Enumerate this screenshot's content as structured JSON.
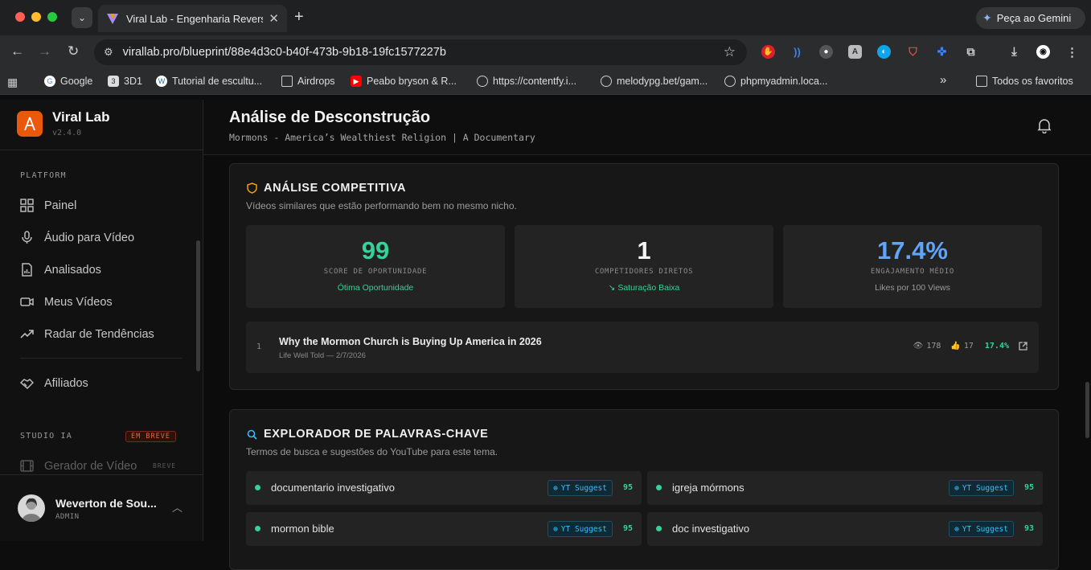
{
  "browser": {
    "tab_title": "Viral Lab - Engenharia Reversa",
    "tab_close": "✕",
    "gemini_label": "Peça ao Gemini",
    "url": "virallab.pro/blueprint/88e4d3c0-b40f-473b-9b18-19fc1577227b",
    "bookmarks": [
      "Google",
      "3D1",
      "Tutorial de escultu...",
      "Airdrops",
      "Peabo bryson & R...",
      "https://contentfy.i...",
      "melodypg.bet/gam...",
      "phpmyadmin.loca..."
    ],
    "all_bookmarks": "Todos os favoritos",
    "more_bookmarks": "»",
    "colors": {
      "chrome_dark": "#1f2021",
      "toolbar": "#2b2c2e"
    }
  },
  "sidebar": {
    "brand": "Viral Lab",
    "version": "v2.4.0",
    "platform_label": "PLATFORM",
    "items": [
      {
        "label": "Painel",
        "icon": "grid-icon"
      },
      {
        "label": "Áudio para Vídeo",
        "icon": "mic-icon"
      },
      {
        "label": "Analisados",
        "icon": "report-icon"
      },
      {
        "label": "Meus Vídeos",
        "icon": "video-icon"
      },
      {
        "label": "Radar de Tendências",
        "icon": "trending-icon"
      }
    ],
    "affiliates": "Afiliados",
    "studio_label": "STUDIO IA",
    "soon_badge": "EM BREVE",
    "studio_item": "Gerador de Vídeo",
    "studio_item_badge": "BREVE",
    "user": {
      "name": "Weverton de Sou...",
      "role": "ADMIN"
    },
    "accent": "#ea580c"
  },
  "header": {
    "title": "Análise de Desconstrução",
    "subtitle": "Mormons - America’s Wealthiest Religion | A Documentary"
  },
  "competitive": {
    "title": "ANÁLISE COMPETITIVA",
    "desc": "Vídeos similares que estão performando bem no mesmo nicho.",
    "stats": [
      {
        "value": "99",
        "label": "SCORE DE OPORTUNIDADE",
        "note": "Ótima Oportunidade",
        "color": "#34d399",
        "note_color": "#34d399"
      },
      {
        "value": "1",
        "label": "COMPETIDORES DIRETOS",
        "note": "Saturação Baixa",
        "color": "#f3f3f3",
        "note_color": "#34d399"
      },
      {
        "value": "17.4%",
        "label": "ENGAJAMENTO MÉDIO",
        "note": "Likes por 100 Views",
        "color": "#60a5fa",
        "note_color": "#9a9a9a"
      }
    ],
    "competitors": [
      {
        "index": "1",
        "title": "Why the Mormon Church is Buying Up America in 2026",
        "meta": "Life Well Told — 2/7/2026",
        "views": "178",
        "likes": "17",
        "engagement": "17.4%"
      }
    ]
  },
  "keywords": {
    "title": "EXPLORADOR DE PALAVRAS-CHAVE",
    "desc": "Termos de busca e sugestões do YouTube para este tema.",
    "items": [
      {
        "term": "documentario investigativo",
        "source": "YT Suggest",
        "score": "95"
      },
      {
        "term": "igreja mórmons",
        "source": "YT Suggest",
        "score": "95"
      },
      {
        "term": "mormon bible",
        "source": "YT Suggest",
        "score": "95"
      },
      {
        "term": "doc investigativo",
        "source": "YT Suggest",
        "score": "93"
      }
    ]
  }
}
